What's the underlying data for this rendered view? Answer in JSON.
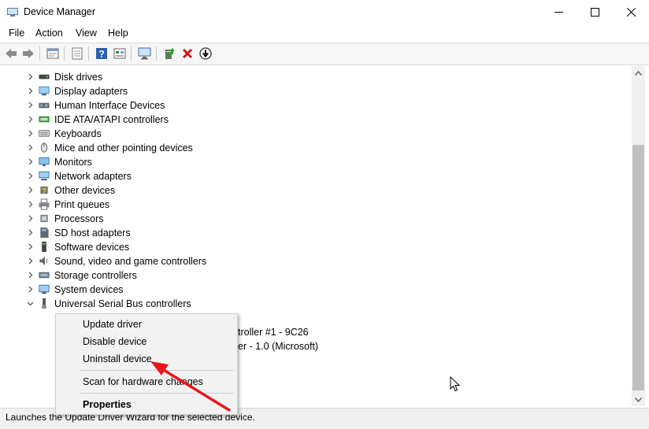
{
  "window": {
    "title": "Device Manager",
    "icons": [
      "app-icon",
      "minimize-icon",
      "maximize-icon",
      "close-icon"
    ]
  },
  "menu": [
    "File",
    "Action",
    "View",
    "Help"
  ],
  "toolbar": {
    "icons": [
      "back-icon",
      "forward-icon",
      "properties-icon",
      "list-icon",
      "help-icon",
      "details-icon",
      "scan-hardware-icon",
      "update-driver-icon",
      "uninstall-icon",
      "disable-icon"
    ]
  },
  "tree": [
    {
      "label": "Disk drives",
      "icon": "disk-drive-icon"
    },
    {
      "label": "Display adapters",
      "icon": "display-adapter-icon"
    },
    {
      "label": "Human Interface Devices",
      "icon": "hid-icon"
    },
    {
      "label": "IDE ATA/ATAPI controllers",
      "icon": "ide-controller-icon"
    },
    {
      "label": "Keyboards",
      "icon": "keyboard-icon"
    },
    {
      "label": "Mice and other pointing devices",
      "icon": "mouse-icon"
    },
    {
      "label": "Monitors",
      "icon": "monitor-icon"
    },
    {
      "label": "Network adapters",
      "icon": "network-adapter-icon"
    },
    {
      "label": "Other devices",
      "icon": "other-devices-icon"
    },
    {
      "label": "Print queues",
      "icon": "printer-icon"
    },
    {
      "label": "Processors",
      "icon": "processor-icon"
    },
    {
      "label": "SD host adapters",
      "icon": "sd-host-icon"
    },
    {
      "label": "Software devices",
      "icon": "software-device-icon"
    },
    {
      "label": "Sound, video and game controllers",
      "icon": "sound-icon"
    },
    {
      "label": "Storage controllers",
      "icon": "storage-controller-icon"
    },
    {
      "label": "System devices",
      "icon": "system-device-icon"
    },
    {
      "label": "Universal Serial Bus controllers",
      "icon": "usb-icon",
      "expanded": true
    }
  ],
  "usb_children_partial": [
    "troller #1 - 9C26",
    "er - 1.0 (Microsoft)"
  ],
  "context_menu": {
    "items": [
      "Update driver",
      "Disable device",
      "Uninstall device",
      "Scan for hardware changes",
      "Properties"
    ]
  },
  "status": "Launches the Update Driver Wizard for the selected device.",
  "colors": {
    "arrow": "#e8161b",
    "menu_bg": "#f2f2f2"
  }
}
